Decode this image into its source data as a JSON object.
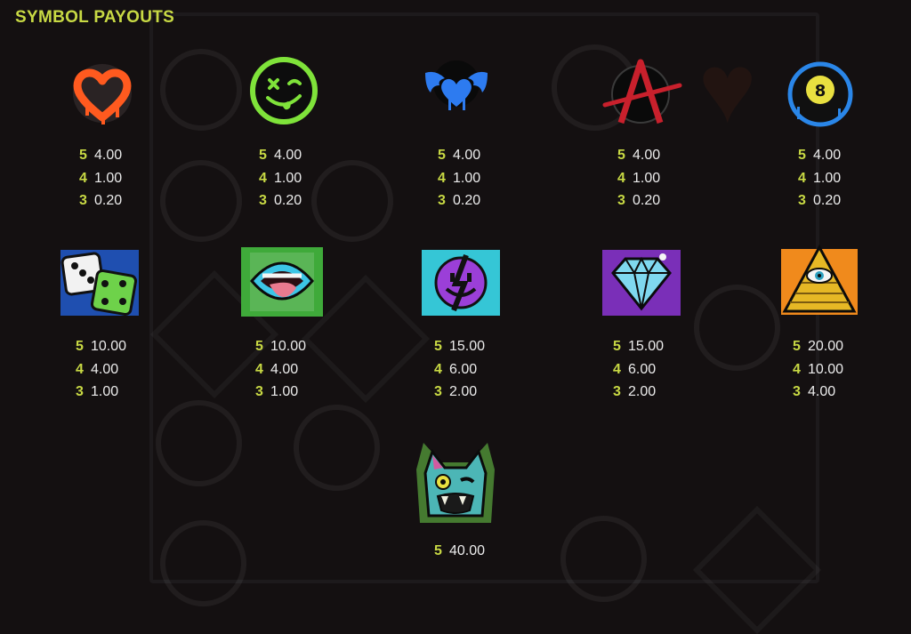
{
  "title": "SYMBOL PAYOUTS",
  "symbols": [
    {
      "icon": "graffiti-heart-icon",
      "payouts": [
        {
          "count": "5",
          "value": "4.00"
        },
        {
          "count": "4",
          "value": "1.00"
        },
        {
          "count": "3",
          "value": "0.20"
        }
      ]
    },
    {
      "icon": "green-smiley-face-icon",
      "payouts": [
        {
          "count": "5",
          "value": "4.00"
        },
        {
          "count": "4",
          "value": "1.00"
        },
        {
          "count": "3",
          "value": "0.20"
        }
      ]
    },
    {
      "icon": "blue-winged-heart-icon",
      "payouts": [
        {
          "count": "5",
          "value": "4.00"
        },
        {
          "count": "4",
          "value": "1.00"
        },
        {
          "count": "3",
          "value": "0.20"
        }
      ]
    },
    {
      "icon": "anarchy-symbol-icon",
      "payouts": [
        {
          "count": "5",
          "value": "4.00"
        },
        {
          "count": "4",
          "value": "1.00"
        },
        {
          "count": "3",
          "value": "0.20"
        }
      ]
    },
    {
      "icon": "eight-ball-icon",
      "payouts": [
        {
          "count": "5",
          "value": "4.00"
        },
        {
          "count": "4",
          "value": "1.00"
        },
        {
          "count": "3",
          "value": "0.20"
        }
      ]
    },
    {
      "icon": "dice-icon",
      "payouts": [
        {
          "count": "5",
          "value": "10.00"
        },
        {
          "count": "4",
          "value": "4.00"
        },
        {
          "count": "3",
          "value": "1.00"
        }
      ]
    },
    {
      "icon": "mouth-tongue-icon",
      "payouts": [
        {
          "count": "5",
          "value": "10.00"
        },
        {
          "count": "4",
          "value": "4.00"
        },
        {
          "count": "3",
          "value": "1.00"
        }
      ]
    },
    {
      "icon": "purple-smiley-lightning-icon",
      "payouts": [
        {
          "count": "5",
          "value": "15.00"
        },
        {
          "count": "4",
          "value": "6.00"
        },
        {
          "count": "3",
          "value": "2.00"
        }
      ]
    },
    {
      "icon": "diamond-icon",
      "payouts": [
        {
          "count": "5",
          "value": "15.00"
        },
        {
          "count": "4",
          "value": "6.00"
        },
        {
          "count": "3",
          "value": "2.00"
        }
      ]
    },
    {
      "icon": "pyramid-eye-icon",
      "payouts": [
        {
          "count": "5",
          "value": "20.00"
        },
        {
          "count": "4",
          "value": "10.00"
        },
        {
          "count": "3",
          "value": "4.00"
        }
      ]
    },
    {
      "icon": "zombie-cat-wild-icon",
      "payouts": [
        {
          "count": "5",
          "value": "40.00"
        }
      ]
    }
  ],
  "colors": {
    "background": "#141011",
    "title": "#c8d944",
    "count": "#c8d944",
    "value": "#ececec"
  }
}
